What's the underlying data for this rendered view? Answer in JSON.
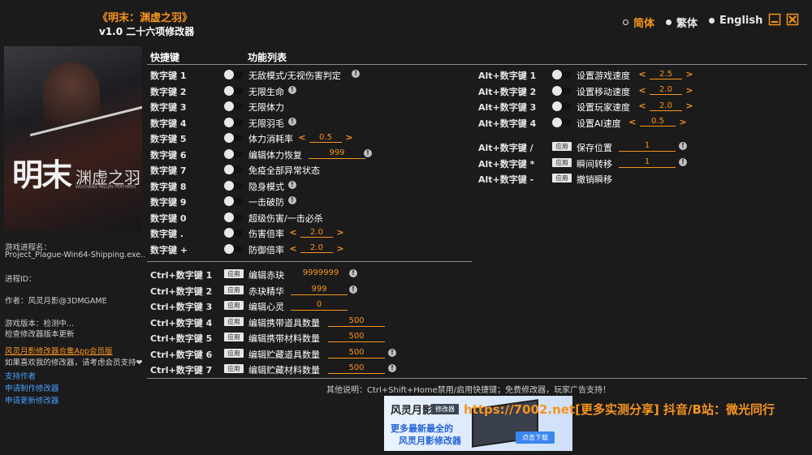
{
  "header": {
    "title": "《明末：渊虚之羽》",
    "subtitle": "v1.0 二十六项修改器",
    "languages": [
      {
        "label": "简体",
        "active": true
      },
      {
        "label": "繁体",
        "active": false
      },
      {
        "label": "English",
        "active": false
      }
    ]
  },
  "cover": {
    "title_big": "明末",
    "title_side": "渊虚之羽",
    "tiny": "WUCHANG FALLEN FEATHERS"
  },
  "sidebar": {
    "process_label": "游戏进程名：",
    "process_value": "Project_Plague-Win64-Shipping.exe...",
    "pid_label": "进程ID：",
    "author": "作者：风灵月影@3DMGAME",
    "version_check": "游戏版本：检测中...",
    "check_hint": "检查修改器版本更新",
    "vip_link": "风灵月影修改器合集App会员版",
    "support_note": "如果喜欢我的修改器，请考虑会员支持❤",
    "link_support": "支持作者",
    "link_request": "申请制作修改器",
    "link_update": "申请更新修改器"
  },
  "columns": {
    "hotkey": "快捷键",
    "functions": "功能列表"
  },
  "left_list": [
    {
      "key": "数字键 1",
      "label": "无敌模式/无视伤害判定",
      "info": true
    },
    {
      "key": "数字键 2",
      "label": "无限生命",
      "info": true
    },
    {
      "key": "数字键 3",
      "label": "无限体力",
      "info": false
    },
    {
      "key": "数字键 4",
      "label": "无限羽毛",
      "info": true
    },
    {
      "key": "数字键 5",
      "label": "体力消耗率",
      "stepper": "0.5"
    },
    {
      "key": "数字键 6",
      "label": "编辑体力恢复",
      "value": "999",
      "info": true
    },
    {
      "key": "数字键 7",
      "label": "免疫全部异常状态",
      "info": false
    },
    {
      "key": "数字键 8",
      "label": "隐身模式",
      "info": true
    },
    {
      "key": "数字键 9",
      "label": "一击破防",
      "info": true
    },
    {
      "key": "数字键 0",
      "label": "超级伤害/一击必杀",
      "info": false
    },
    {
      "key": "数字键 .",
      "label": "伤害倍率",
      "stepper": "2.0"
    },
    {
      "key": "数字键 +",
      "label": "防御倍率",
      "stepper": "2.0"
    }
  ],
  "ctrl_list": [
    {
      "key": "Ctrl+数字键 1",
      "label": "编辑赤玦",
      "value": "9999999",
      "info": true
    },
    {
      "key": "Ctrl+数字键 2",
      "label": "赤玦精华",
      "value": "999",
      "info": true
    },
    {
      "key": "Ctrl+数字键 3",
      "label": "编辑心灵",
      "value": "0",
      "info": false
    },
    {
      "key": "Ctrl+数字键 4",
      "label": "编辑携带道具数量",
      "value": "500",
      "info": false
    },
    {
      "key": "Ctrl+数字键 5",
      "label": "编辑携带材料数量",
      "value": "500",
      "info": false
    },
    {
      "key": "Ctrl+数字键 6",
      "label": "编辑贮藏道具数量",
      "value": "500",
      "info": true
    },
    {
      "key": "Ctrl+数字键 7",
      "label": "编辑贮藏材料数量",
      "value": "500",
      "info": true
    }
  ],
  "alt_list": [
    {
      "key": "Alt+数字键 1",
      "label": "设置游戏速度",
      "stepper": "2.5"
    },
    {
      "key": "Alt+数字键 2",
      "label": "设置移动速度",
      "stepper": "2.0"
    },
    {
      "key": "Alt+数字键 3",
      "label": "设置玩家速度",
      "stepper": "2.0"
    },
    {
      "key": "Alt+数字键 4",
      "label": "设置AI速度",
      "stepper": "0.5"
    }
  ],
  "alt_apply_list": [
    {
      "key": "Alt+数字键 /",
      "label": "保存位置",
      "value": "1",
      "info": true
    },
    {
      "key": "Alt+数字键 *",
      "label": "瞬间转移",
      "value": "1",
      "info": true
    },
    {
      "key": "Alt+数字键 -",
      "label": "撤销瞬移",
      "value": "",
      "info": false
    }
  ],
  "apply_label": "应用",
  "footer_note": "其他说明：Ctrl+Shift+Home禁用/启用快捷键；免费修改器，玩家广告支持！",
  "banner": {
    "logo": "风灵月影",
    "badge": "修改器",
    "line1": "更多最新最全的",
    "line2": "风灵月影修改器",
    "download": "点击下载"
  },
  "promo_text": "https://7002.net[更多实测分享] 抖音/B站：微光同行",
  "colors": {
    "accent": "#f7941d",
    "background": "#1b1b1b",
    "link": "#4a9eff"
  }
}
